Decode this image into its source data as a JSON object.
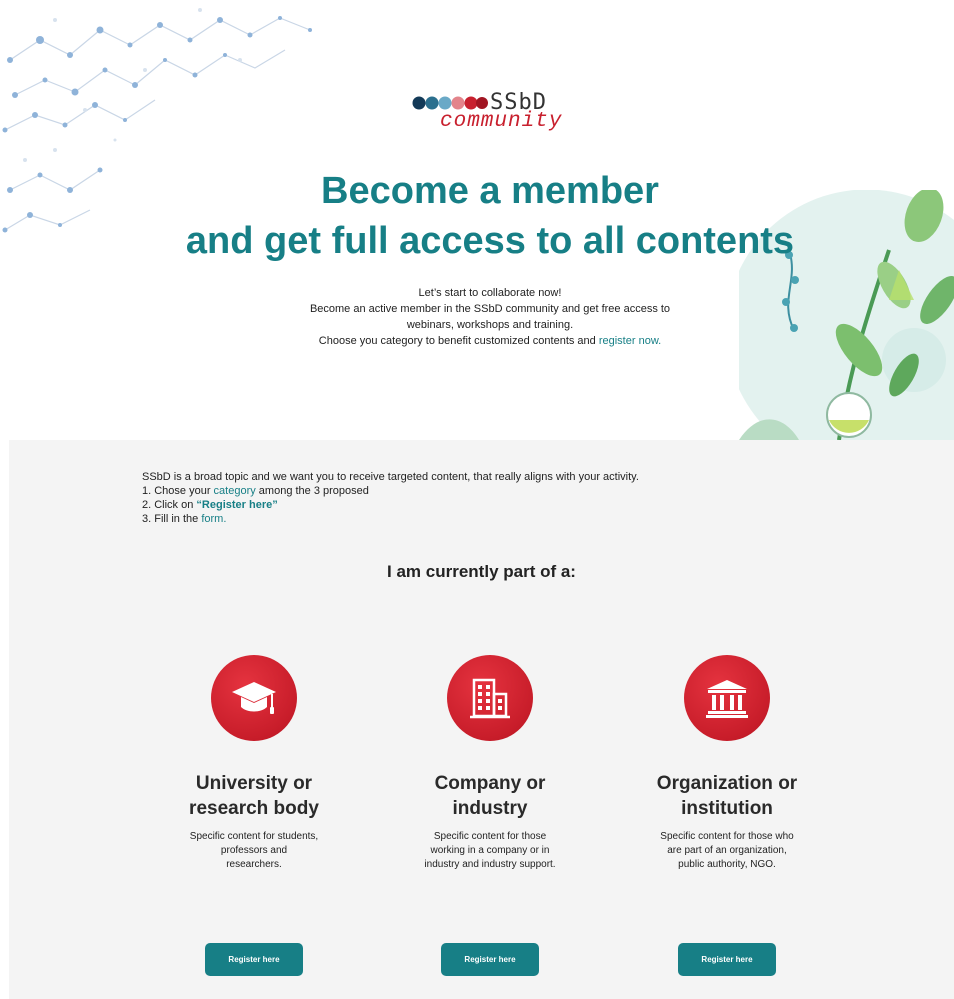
{
  "logo": {
    "brand": "SSbD",
    "community": "community"
  },
  "hero": {
    "title_line1": "Become a member",
    "title_line2": "and get full access to all contents",
    "intro_line1": "Let’s start to collaborate now!",
    "intro_line2": "Become an active member in the SSbD community and get free access to",
    "intro_line3": "webinars, workshops and training.",
    "intro_line4_prefix": "Choose you category to benefit customized contents and ",
    "intro_link": "register now."
  },
  "steps": {
    "intro": "SSbD is a broad topic and we want you to receive targeted content, that really aligns with your activity.",
    "step1_prefix": "1. Chose your ",
    "step1_link": "category",
    "step1_suffix": " among the 3 proposed",
    "step2_prefix": "2. Click on ",
    "step2_link": "“Register here”",
    "step3_prefix": "3. Fill in the ",
    "step3_link": "form."
  },
  "section": {
    "title": "I am currently part of a:"
  },
  "categories": [
    {
      "icon": "graduation-cap-icon",
      "title_line1": "University or",
      "title_line2": "research body",
      "desc_line1": "Specific content for students,",
      "desc_line2": "professors and",
      "desc_line3": "researchers.",
      "button": "Register here"
    },
    {
      "icon": "building-icon",
      "title_line1": "Company or",
      "title_line2": "industry",
      "desc_line1": "Specific content for those",
      "desc_line2": "working in a company or in",
      "desc_line3": "industry and industry support.",
      "button": "Register here"
    },
    {
      "icon": "institution-icon",
      "title_line1": "Organization or",
      "title_line2": "institution",
      "desc_line1": "Specific content for those who",
      "desc_line2": "are part of an organization,",
      "desc_line3": "public authority, NGO.",
      "button": "Register here"
    }
  ],
  "colors": {
    "accent_teal": "#177f86",
    "accent_red": "#c81d2a",
    "section_bg": "#f4f4f4"
  }
}
